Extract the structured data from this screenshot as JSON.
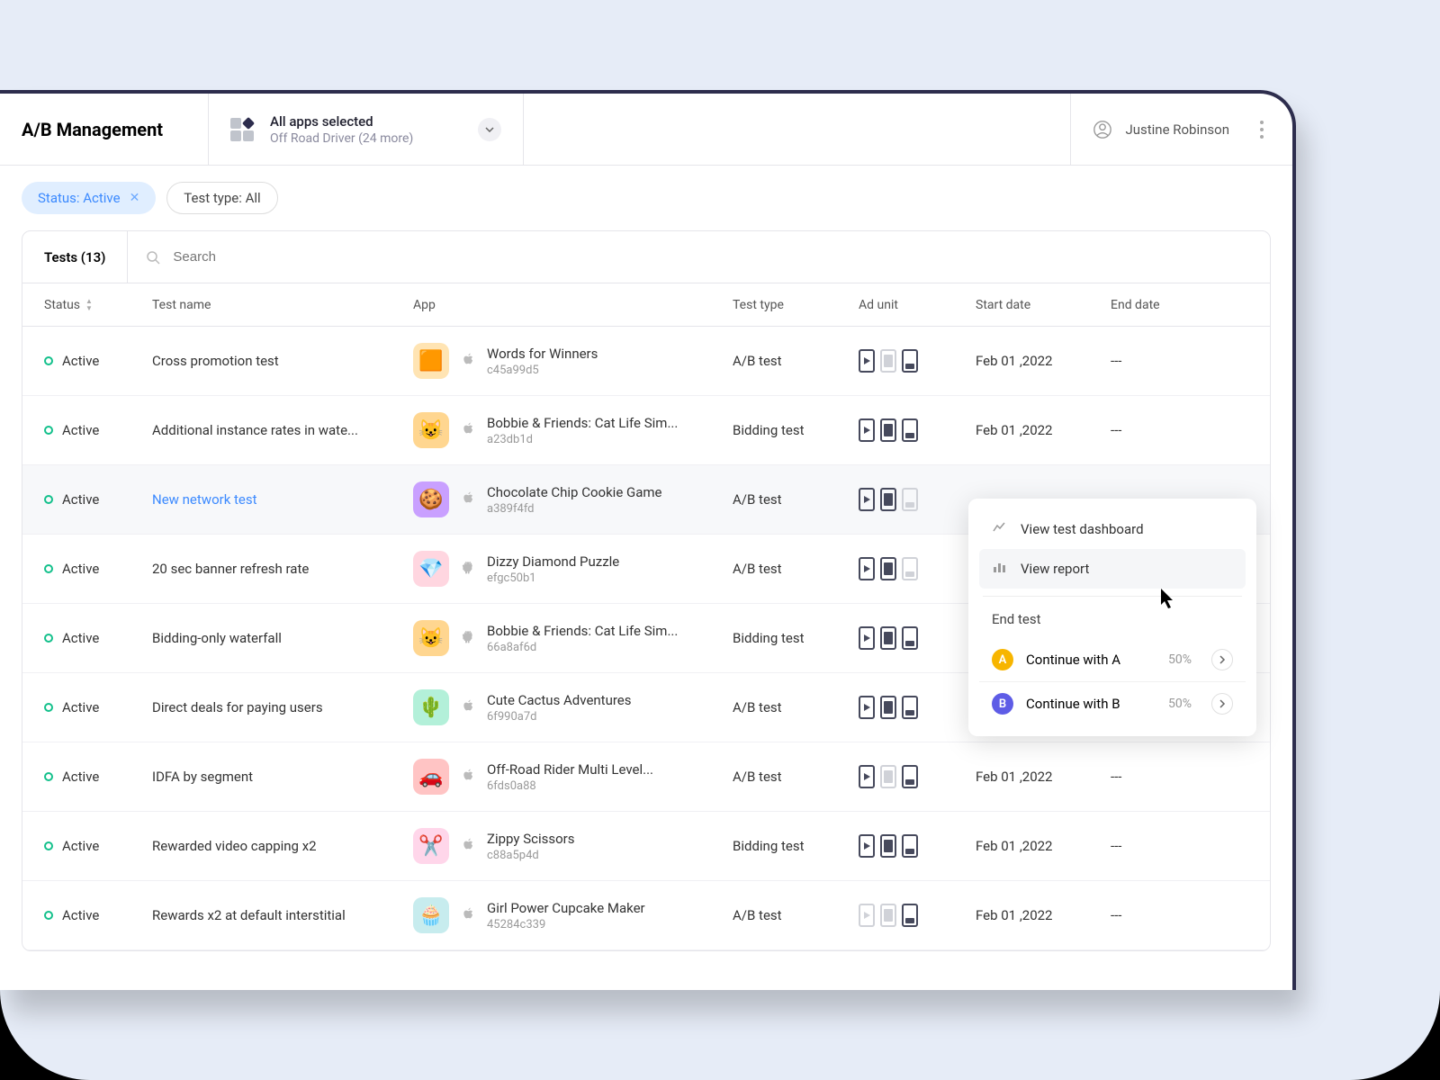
{
  "header": {
    "title": "A/B Management",
    "apps_main": "All apps selected",
    "apps_sub": "Off Road Driver (24 more)",
    "user_name": "Justine Robinson"
  },
  "filters": {
    "status": "Status: Active",
    "type": "Test type: All"
  },
  "card_header": {
    "count": "Tests (13)",
    "search_placeholder": "Search"
  },
  "columns": {
    "status": "Status",
    "test_name": "Test name",
    "app": "App",
    "test_type": "Test type",
    "ad_unit": "Ad unit",
    "start_date": "Start date",
    "end_date": "End date"
  },
  "rows": [
    {
      "status": "Active",
      "test_name": "Cross promotion test",
      "link": false,
      "app_name": "Words for Winners",
      "app_id": "c45a99d5",
      "platform": "apple",
      "icon_bg": "#ffe4b3",
      "icon_emoji": "🟧",
      "test_type": "A/B test",
      "adunits": [
        "play-on",
        "fill-off",
        "btm-on"
      ],
      "start": "Feb 01 ,2022",
      "end": "---",
      "hovered": false
    },
    {
      "status": "Active",
      "test_name": "Additional instance rates in wate...",
      "link": false,
      "app_name": "Bobbie & Friends: Cat Life Sim...",
      "app_id": "a23db1d",
      "platform": "apple",
      "icon_bg": "#ffd690",
      "icon_emoji": "😺",
      "test_type": "Bidding test",
      "adunits": [
        "play-on",
        "fill-on",
        "btm-on"
      ],
      "start": "Feb 01 ,2022",
      "end": "---",
      "hovered": false
    },
    {
      "status": "Active",
      "test_name": "New network test",
      "link": true,
      "app_name": "Chocolate Chip Cookie Game",
      "app_id": "a389f4fd",
      "platform": "apple",
      "icon_bg": "#c9a0ff",
      "icon_emoji": "🍪",
      "test_type": "A/B test",
      "adunits": [
        "play-on",
        "fill-on",
        "btm-off"
      ],
      "start": "",
      "end": "",
      "hovered": true
    },
    {
      "status": "Active",
      "test_name": "20 sec banner refresh rate",
      "link": false,
      "app_name": "Dizzy Diamond Puzzle",
      "app_id": "efgc50b1",
      "platform": "android",
      "icon_bg": "#ffd6e0",
      "icon_emoji": "💎",
      "test_type": "A/B test",
      "adunits": [
        "play-on",
        "fill-on",
        "btm-off"
      ],
      "start": "",
      "end": "",
      "hovered": false
    },
    {
      "status": "Active",
      "test_name": "Bidding-only waterfall",
      "link": false,
      "app_name": "Bobbie & Friends: Cat Life Sim...",
      "app_id": "66a8af6d",
      "platform": "android",
      "icon_bg": "#ffd690",
      "icon_emoji": "😺",
      "test_type": "Bidding test",
      "adunits": [
        "play-on",
        "fill-on",
        "btm-on"
      ],
      "start": "",
      "end": "",
      "hovered": false
    },
    {
      "status": "Active",
      "test_name": "Direct deals for paying users",
      "link": false,
      "app_name": "Cute Cactus Adventures",
      "app_id": "6f990a7d",
      "platform": "apple",
      "icon_bg": "#b3f0d9",
      "icon_emoji": "🌵",
      "test_type": "A/B test",
      "adunits": [
        "play-on",
        "fill-on",
        "btm-on"
      ],
      "start": "",
      "end": "",
      "hovered": false
    },
    {
      "status": "Active",
      "test_name": "IDFA by segment",
      "link": false,
      "app_name": "Off-Road Rider Multi Level...",
      "app_id": "6fds0a88",
      "platform": "apple",
      "icon_bg": "#ffc4c4",
      "icon_emoji": "🚗",
      "test_type": "A/B test",
      "adunits": [
        "play-on",
        "fill-off",
        "btm-on"
      ],
      "start": "Feb 01 ,2022",
      "end": "---",
      "hovered": false
    },
    {
      "status": "Active",
      "test_name": "Rewarded video capping x2",
      "link": false,
      "app_name": "Zippy Scissors",
      "app_id": "c88a5p4d",
      "platform": "apple",
      "icon_bg": "#ffd6ea",
      "icon_emoji": "✂️",
      "test_type": "Bidding test",
      "adunits": [
        "play-on",
        "fill-on",
        "btm-on"
      ],
      "start": "Feb 01 ,2022",
      "end": "---",
      "hovered": false
    },
    {
      "status": "Active",
      "test_name": "Rewards x2 at default interstitial",
      "link": false,
      "app_name": "Girl Power Cupcake Maker",
      "app_id": "45284c339",
      "platform": "apple",
      "icon_bg": "#c7ecee",
      "icon_emoji": "🧁",
      "test_type": "A/B test",
      "adunits": [
        "play-off",
        "fill-off",
        "btm-on"
      ],
      "start": "Feb 01 ,2022",
      "end": "---",
      "hovered": false
    }
  ],
  "popover": {
    "view_dashboard": "View test dashboard",
    "view_report": "View report",
    "end_label": "End test",
    "option_a": "Continue with A",
    "pct_a": "50%",
    "option_b": "Continue with B",
    "pct_b": "50%"
  }
}
